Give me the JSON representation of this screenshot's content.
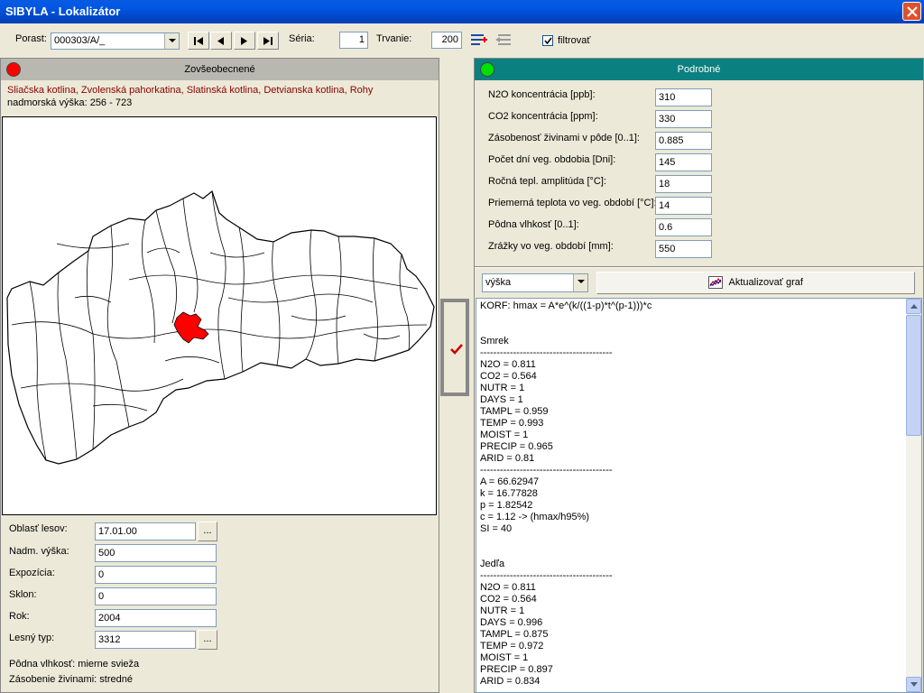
{
  "window": {
    "title": "SIBYLA - Lokalizátor"
  },
  "toolbar": {
    "porast_label": "Porast:",
    "porast_value": "000303/A/_",
    "seria_label": "Séria:",
    "seria_value": "1",
    "trvanie_label": "Trvanie:",
    "trvanie_value": "200",
    "filtrovat_label": "filtrovať",
    "filtrovat_checked": true
  },
  "left": {
    "header": "Zovšeobecnené",
    "status_color": "#ff0000",
    "regions": "Sliačska kotlina, Zvolenská pahorkatina, Slatinská kotlina, Detvianska kotlina, Rohy",
    "altitude": "nadmorská výška: 256 - 723",
    "form": {
      "oblast_label": "Oblasť lesov:",
      "oblast_value": "17.01.00",
      "vyska_label": "Nadm. výška:",
      "vyska_value": "500",
      "expozicia_label": "Expozícia:",
      "expozicia_value": "0",
      "sklon_label": "Sklon:",
      "sklon_value": "0",
      "rok_label": "Rok:",
      "rok_value": "2004",
      "typ_label": "Lesný typ:",
      "typ_value": "3312",
      "dots": "..."
    },
    "soil_moisture": "Pôdna vlhkosť: mierne svieža",
    "nutrient_supply": "Zásobenie živinami: stredné"
  },
  "right": {
    "header": "Podrobné",
    "status_color": "#00e000",
    "params": [
      {
        "label": "N2O koncentrácia [ppb]:",
        "value": "310"
      },
      {
        "label": "CO2 koncentrácia [ppm]:",
        "value": "330"
      },
      {
        "label": "Zásobenosť živinami v pôde [0..1]:",
        "value": "0.885"
      },
      {
        "label": "Počet dní veg. obdobia [Dni]:",
        "value": "145"
      },
      {
        "label": "Ročná tepl. amplitúda [°C]:",
        "value": "18"
      },
      {
        "label": "Priemerná teplota vo veg. období [°C]:",
        "value": "14"
      },
      {
        "label": "Pôdna vlhkosť [0..1]:",
        "value": "0.6"
      },
      {
        "label": "Zrážky vo veg. období [mm]:",
        "value": "550"
      }
    ],
    "graph_select": "výška",
    "update_button": "Aktualizovať graf",
    "output_text": "KORF: hmax = A*e^(k/((1-p)*t^(p-1)))*c\n\n\nSmrek\n----------------------------------------\nN2O = 0.811\nCO2 = 0.564\nNUTR = 1\nDAYS = 1\nTAMPL = 0.959\nTEMP = 0.993\nMOIST = 1\nPRECIP = 0.965\nARID = 0.81\n----------------------------------------\nA = 66.62947\nk = 16.77828\np = 1.82542\nc = 1.12 -> (hmax/h95%)\nSI = 40\n\n\nJedľa\n----------------------------------------\nN2O = 0.811\nCO2 = 0.564\nNUTR = 1\nDAYS = 0.996\nTAMPL = 0.875\nTEMP = 0.972\nMOIST = 1\nPRECIP = 0.897\nARID = 0.834"
  }
}
